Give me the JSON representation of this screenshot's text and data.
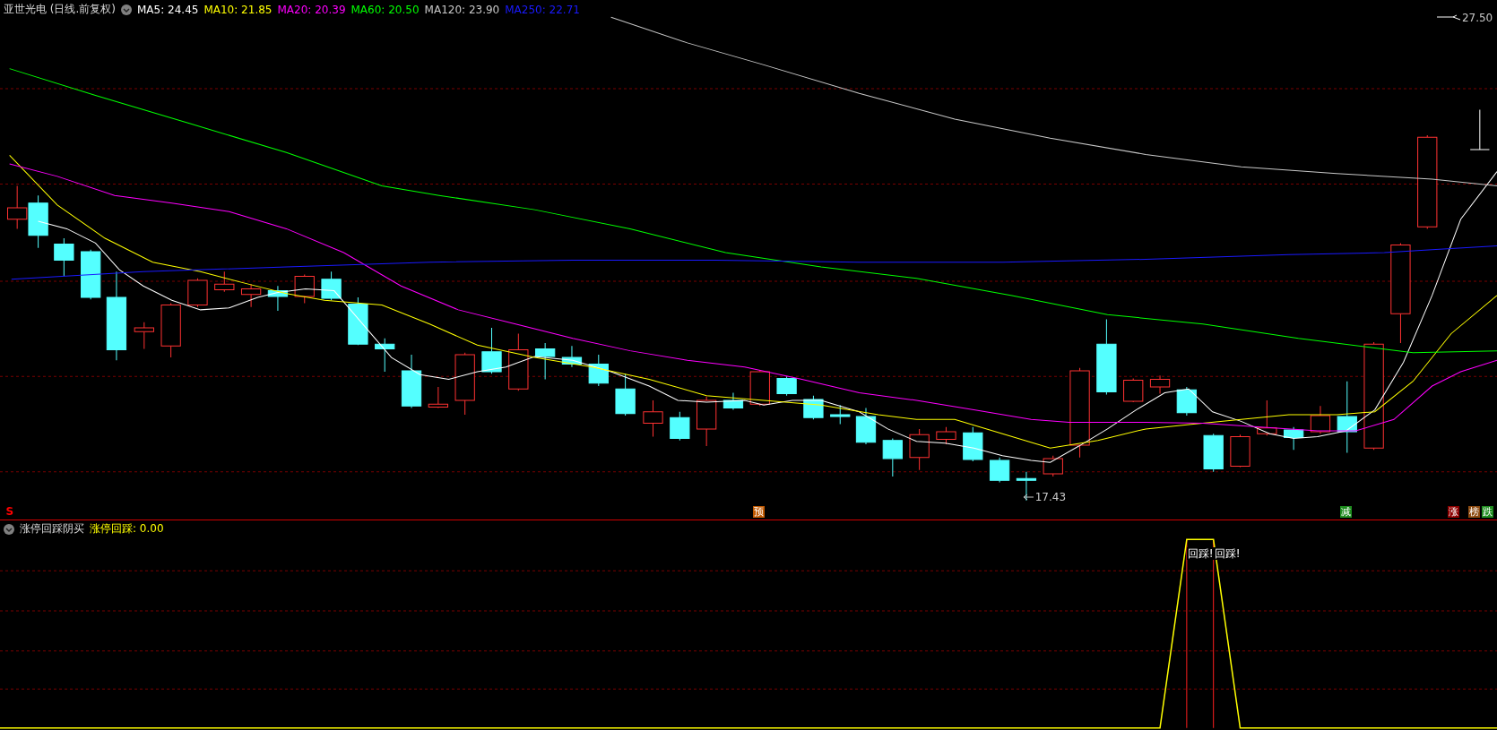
{
  "header": {
    "title": "亚世光电 (日线.前复权)",
    "indicators": [
      {
        "label": "MA5: 24.45",
        "color": "#ffffff"
      },
      {
        "label": "MA10: 21.85",
        "color": "#ffff00"
      },
      {
        "label": "MA20: 20.39",
        "color": "#ff00ff"
      },
      {
        "label": "MA60: 20.50",
        "color": "#00ff00"
      },
      {
        "label": "MA120: 23.90",
        "color": "#c8c8c8"
      },
      {
        "label": "MA250: 22.71",
        "color": "#1a1aff"
      }
    ]
  },
  "price_labels": [
    {
      "kind": "high",
      "text": "27.50"
    },
    {
      "kind": "low",
      "text": "17.43"
    }
  ],
  "signals": [
    {
      "kind": "letter",
      "text": "S",
      "color": "#ff0000"
    },
    {
      "kind": "tag",
      "text": "预",
      "color": "#c05800"
    },
    {
      "kind": "tag",
      "text": "减",
      "color": "#1e8c1e"
    },
    {
      "kind": "tag",
      "text": "涨",
      "color": "#8c0000"
    },
    {
      "kind": "tag",
      "text": "榜",
      "color": "#8c4a10"
    },
    {
      "kind": "tag",
      "text": "跌",
      "color": "#1e8c1e"
    }
  ],
  "indicator_pane": {
    "title": "涨停回踩阴买",
    "values": [
      {
        "label": "涨停回踩: 0.00",
        "color": "#ffff00"
      }
    ],
    "annotations": [
      "回踩!",
      "回踩!"
    ]
  }
}
